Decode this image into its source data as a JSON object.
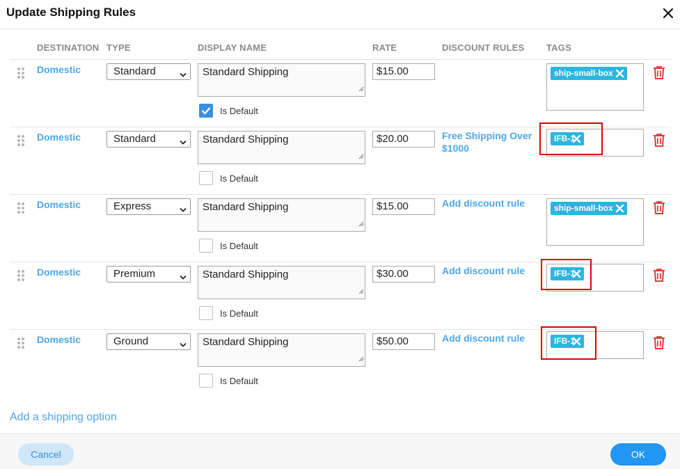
{
  "dialog": {
    "title": "Update Shipping Rules",
    "close_icon": "close-x-icon"
  },
  "columns": {
    "destination": "DESTINATION",
    "type": "TYPE",
    "display_name": "DISPLAY NAME",
    "rate": "RATE",
    "discount_rules": "DISCOUNT RULES",
    "tags": "TAGS"
  },
  "rows": [
    {
      "destination": "Domestic",
      "type": "Standard",
      "display_name": "Standard Shipping",
      "is_default_label": "Is Default",
      "is_default": true,
      "rate": "$15.00",
      "discount": "",
      "tag": "ship-small-box",
      "highlighted": false
    },
    {
      "destination": "Domestic",
      "type": "Standard",
      "display_name": "Standard Shipping",
      "is_default_label": "Is Default",
      "is_default": false,
      "rate": "$20.00",
      "discount": "Free Shipping Over $1000",
      "tag": "IFB-1",
      "highlighted": true
    },
    {
      "destination": "Domestic",
      "type": "Express",
      "display_name": "Standard Shipping",
      "is_default_label": "Is Default",
      "is_default": false,
      "rate": "$15.00",
      "discount": "Add discount rule",
      "tag": "ship-small-box",
      "highlighted": false
    },
    {
      "destination": "Domestic",
      "type": "Premium",
      "display_name": "Standard Shipping",
      "is_default_label": "Is Default",
      "is_default": false,
      "rate": "$30.00",
      "discount": "Add discount rule",
      "tag": "IFB-1",
      "highlighted": true
    },
    {
      "destination": "Domestic",
      "type": "Ground",
      "display_name": "Standard Shipping",
      "is_default_label": "Is Default",
      "is_default": false,
      "rate": "$50.00",
      "discount": "Add discount rule",
      "tag": "IFB-1",
      "highlighted": true
    }
  ],
  "add_option_label": "Add a shipping option",
  "footer": {
    "cancel_label": "Cancel",
    "ok_label": "OK"
  },
  "colors": {
    "link": "#4ea6e8",
    "tag": "#2bb5e0",
    "delete": "#e53935",
    "highlight": "#e00000",
    "primary": "#2196f3"
  },
  "icons": {
    "drag": "drag-handle-icon",
    "chevron": "chevron-down-icon",
    "check": "checkmark-icon",
    "tag_remove": "tag-remove-x-icon",
    "delete": "trash-icon"
  }
}
